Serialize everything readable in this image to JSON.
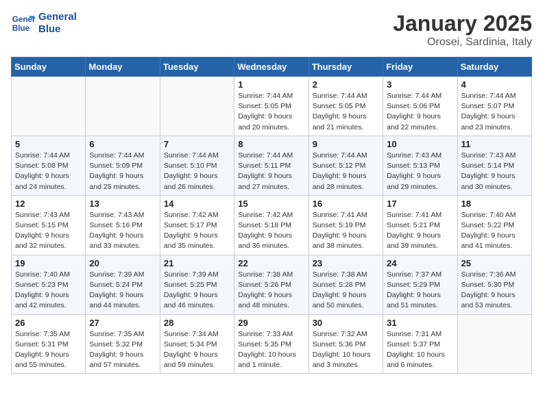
{
  "header": {
    "logo_line1": "General",
    "logo_line2": "Blue",
    "month_title": "January 2025",
    "location": "Orosei, Sardinia, Italy"
  },
  "days_of_week": [
    "Sunday",
    "Monday",
    "Tuesday",
    "Wednesday",
    "Thursday",
    "Friday",
    "Saturday"
  ],
  "weeks": [
    [
      {
        "day": "",
        "info": ""
      },
      {
        "day": "",
        "info": ""
      },
      {
        "day": "",
        "info": ""
      },
      {
        "day": "1",
        "info": "Sunrise: 7:44 AM\nSunset: 5:05 PM\nDaylight: 9 hours\nand 20 minutes."
      },
      {
        "day": "2",
        "info": "Sunrise: 7:44 AM\nSunset: 5:05 PM\nDaylight: 9 hours\nand 21 minutes."
      },
      {
        "day": "3",
        "info": "Sunrise: 7:44 AM\nSunset: 5:06 PM\nDaylight: 9 hours\nand 22 minutes."
      },
      {
        "day": "4",
        "info": "Sunrise: 7:44 AM\nSunset: 5:07 PM\nDaylight: 9 hours\nand 23 minutes."
      }
    ],
    [
      {
        "day": "5",
        "info": "Sunrise: 7:44 AM\nSunset: 5:08 PM\nDaylight: 9 hours\nand 24 minutes."
      },
      {
        "day": "6",
        "info": "Sunrise: 7:44 AM\nSunset: 5:09 PM\nDaylight: 9 hours\nand 25 minutes."
      },
      {
        "day": "7",
        "info": "Sunrise: 7:44 AM\nSunset: 5:10 PM\nDaylight: 9 hours\nand 26 minutes."
      },
      {
        "day": "8",
        "info": "Sunrise: 7:44 AM\nSunset: 5:11 PM\nDaylight: 9 hours\nand 27 minutes."
      },
      {
        "day": "9",
        "info": "Sunrise: 7:44 AM\nSunset: 5:12 PM\nDaylight: 9 hours\nand 28 minutes."
      },
      {
        "day": "10",
        "info": "Sunrise: 7:43 AM\nSunset: 5:13 PM\nDaylight: 9 hours\nand 29 minutes."
      },
      {
        "day": "11",
        "info": "Sunrise: 7:43 AM\nSunset: 5:14 PM\nDaylight: 9 hours\nand 30 minutes."
      }
    ],
    [
      {
        "day": "12",
        "info": "Sunrise: 7:43 AM\nSunset: 5:15 PM\nDaylight: 9 hours\nand 32 minutes."
      },
      {
        "day": "13",
        "info": "Sunrise: 7:43 AM\nSunset: 5:16 PM\nDaylight: 9 hours\nand 33 minutes."
      },
      {
        "day": "14",
        "info": "Sunrise: 7:42 AM\nSunset: 5:17 PM\nDaylight: 9 hours\nand 35 minutes."
      },
      {
        "day": "15",
        "info": "Sunrise: 7:42 AM\nSunset: 5:18 PM\nDaylight: 9 hours\nand 36 minutes."
      },
      {
        "day": "16",
        "info": "Sunrise: 7:41 AM\nSunset: 5:19 PM\nDaylight: 9 hours\nand 38 minutes."
      },
      {
        "day": "17",
        "info": "Sunrise: 7:41 AM\nSunset: 5:21 PM\nDaylight: 9 hours\nand 39 minutes."
      },
      {
        "day": "18",
        "info": "Sunrise: 7:40 AM\nSunset: 5:22 PM\nDaylight: 9 hours\nand 41 minutes."
      }
    ],
    [
      {
        "day": "19",
        "info": "Sunrise: 7:40 AM\nSunset: 5:23 PM\nDaylight: 9 hours\nand 42 minutes."
      },
      {
        "day": "20",
        "info": "Sunrise: 7:39 AM\nSunset: 5:24 PM\nDaylight: 9 hours\nand 44 minutes."
      },
      {
        "day": "21",
        "info": "Sunrise: 7:39 AM\nSunset: 5:25 PM\nDaylight: 9 hours\nand 46 minutes."
      },
      {
        "day": "22",
        "info": "Sunrise: 7:38 AM\nSunset: 5:26 PM\nDaylight: 9 hours\nand 48 minutes."
      },
      {
        "day": "23",
        "info": "Sunrise: 7:38 AM\nSunset: 5:28 PM\nDaylight: 9 hours\nand 50 minutes."
      },
      {
        "day": "24",
        "info": "Sunrise: 7:37 AM\nSunset: 5:29 PM\nDaylight: 9 hours\nand 51 minutes."
      },
      {
        "day": "25",
        "info": "Sunrise: 7:36 AM\nSunset: 5:30 PM\nDaylight: 9 hours\nand 53 minutes."
      }
    ],
    [
      {
        "day": "26",
        "info": "Sunrise: 7:35 AM\nSunset: 5:31 PM\nDaylight: 9 hours\nand 55 minutes."
      },
      {
        "day": "27",
        "info": "Sunrise: 7:35 AM\nSunset: 5:32 PM\nDaylight: 9 hours\nand 57 minutes."
      },
      {
        "day": "28",
        "info": "Sunrise: 7:34 AM\nSunset: 5:34 PM\nDaylight: 9 hours\nand 59 minutes."
      },
      {
        "day": "29",
        "info": "Sunrise: 7:33 AM\nSunset: 5:35 PM\nDaylight: 10 hours\nand 1 minute."
      },
      {
        "day": "30",
        "info": "Sunrise: 7:32 AM\nSunset: 5:36 PM\nDaylight: 10 hours\nand 3 minutes."
      },
      {
        "day": "31",
        "info": "Sunrise: 7:31 AM\nSunset: 5:37 PM\nDaylight: 10 hours\nand 6 minutes."
      },
      {
        "day": "",
        "info": ""
      }
    ]
  ]
}
